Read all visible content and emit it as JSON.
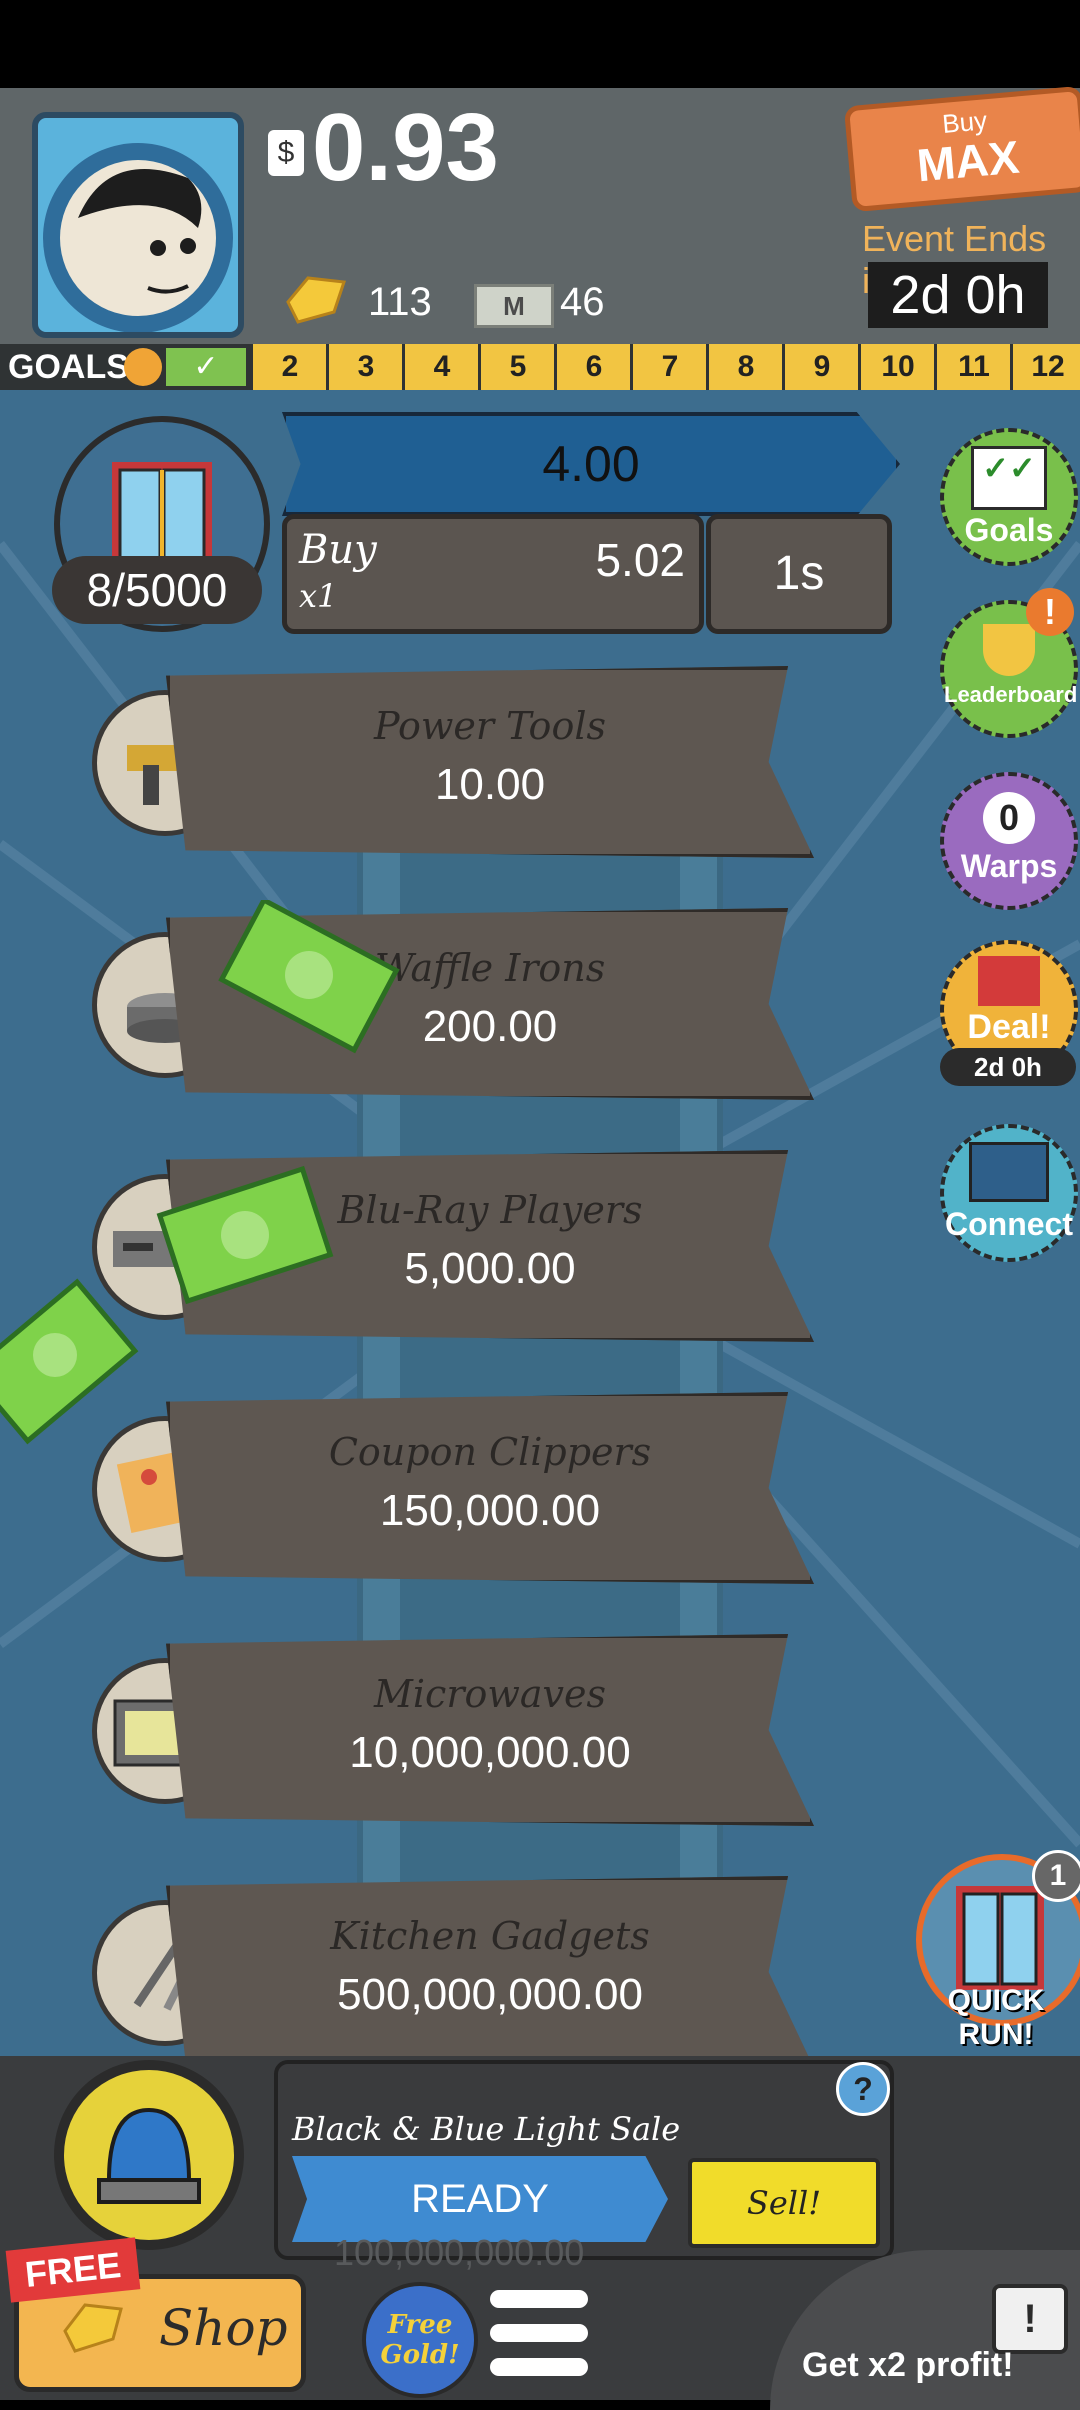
{
  "header": {
    "cash": "0.93",
    "gold": "113",
    "megabucks": "46",
    "buy_max_top": "Buy",
    "buy_max_main": "MAX",
    "event_label": "Event Ends in:",
    "event_time": "2d 0h"
  },
  "goals": {
    "label": "GOALS",
    "levels": [
      "2",
      "3",
      "4",
      "5",
      "6",
      "7",
      "8",
      "9",
      "10",
      "11",
      "12"
    ]
  },
  "featured": {
    "count": "8/5000",
    "progress_value": "4.00",
    "buy_label": "Buy",
    "buy_mult": "x1",
    "buy_cost": "5.02",
    "timer": "1s"
  },
  "businesses": [
    {
      "name": "Power Tools",
      "cost": "10.00"
    },
    {
      "name": "Waffle Irons",
      "cost": "200.00"
    },
    {
      "name": "Blu-Ray Players",
      "cost": "5,000.00"
    },
    {
      "name": "Coupon Clippers",
      "cost": "150,000.00"
    },
    {
      "name": "Microwaves",
      "cost": "10,000,000.00"
    },
    {
      "name": "Kitchen Gadgets",
      "cost": "500,000,000.00"
    }
  ],
  "sidebar": {
    "goals": "Goals",
    "leaderboard": "Leaderboard",
    "leaderboard_alert": "!",
    "warps_count": "0",
    "warps": "Warps",
    "deal": "Deal!",
    "deal_time": "2d 0h",
    "connect": "Connect",
    "quick_run": "QUICK RUN!",
    "quick_run_count": "1"
  },
  "sale": {
    "title": "Black & Blue Light Sale",
    "ready": "READY",
    "sell": "Sell!",
    "help": "?",
    "hidden_value": "100,000,000.00"
  },
  "bottom": {
    "free": "FREE",
    "shop": "Shop",
    "free_gold": "Free Gold!",
    "x2": "Get x2 profit!"
  }
}
